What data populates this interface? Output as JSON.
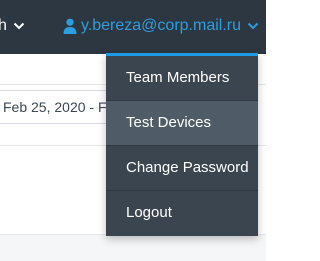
{
  "topbar": {
    "nav_fragment_label": "h",
    "user_email": "y.bereza@corp.mail.ru"
  },
  "content": {
    "date_range_value": "Feb 25, 2020 - Fe"
  },
  "dropdown": {
    "items": [
      {
        "label": "Team Members"
      },
      {
        "label": "Test Devices"
      },
      {
        "label": "Change Password"
      },
      {
        "label": "Logout"
      }
    ],
    "active_item": "Test Devices"
  },
  "colors": {
    "topbar_bg": "#2d3741",
    "dropdown_bg": "#3a4550",
    "dropdown_active_bg": "#4f5b66",
    "accent": "#1e9be6",
    "user_link": "#2d9ee0"
  },
  "icons": {
    "nav_chevron": "chevron-down-icon",
    "user": "user-icon",
    "user_chevron": "chevron-down-icon"
  }
}
